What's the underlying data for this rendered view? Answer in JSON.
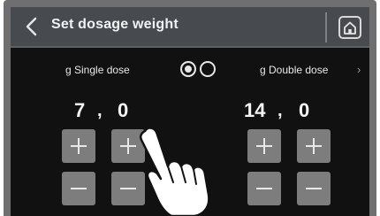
{
  "header": {
    "title": "Set dosage weight",
    "back_icon": "chevron-left-icon",
    "home_icon": "home-icon"
  },
  "modes": {
    "single_label": "g Single dose",
    "double_label": "g Double dose",
    "selected": "single",
    "next_icon": "chevron-right-icon"
  },
  "single": {
    "whole": "7",
    "sep": ",",
    "decimal": "0"
  },
  "double": {
    "whole": "14",
    "sep": ",",
    "decimal": "0"
  },
  "colors": {
    "header_bg": "#474b50",
    "screen_bg": "#111111",
    "button_bg": "#7d7d7d",
    "text": "#f5f5f5"
  }
}
